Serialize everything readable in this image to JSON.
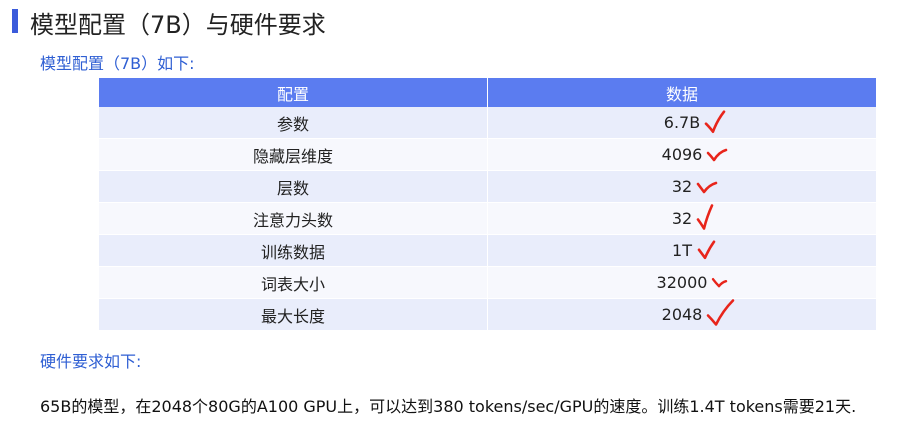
{
  "page": {
    "title": "模型配置（7B）与硬件要求",
    "subtitle": "模型配置（7B）如下:",
    "hardware_label": "硬件要求如下:",
    "description": "65B的模型，在2048个80G的A100 GPU上，可以达到380 tokens/sec/GPU的速度。训练1.4T tokens需要21天."
  },
  "table": {
    "headers": [
      "配置",
      "数据"
    ],
    "rows": [
      {
        "name": "参数",
        "value": "6.7B"
      },
      {
        "name": "隐藏层维度",
        "value": "4096"
      },
      {
        "name": "层数",
        "value": "32"
      },
      {
        "name": "注意力头数",
        "value": "32"
      },
      {
        "name": "训练数据",
        "value": "1T"
      },
      {
        "name": "词表大小",
        "value": "32000"
      },
      {
        "name": "最大长度",
        "value": "2048"
      }
    ]
  },
  "annotations": {
    "mark_icon": "red-checkmark-icon",
    "mark_color": "#e8251b"
  }
}
